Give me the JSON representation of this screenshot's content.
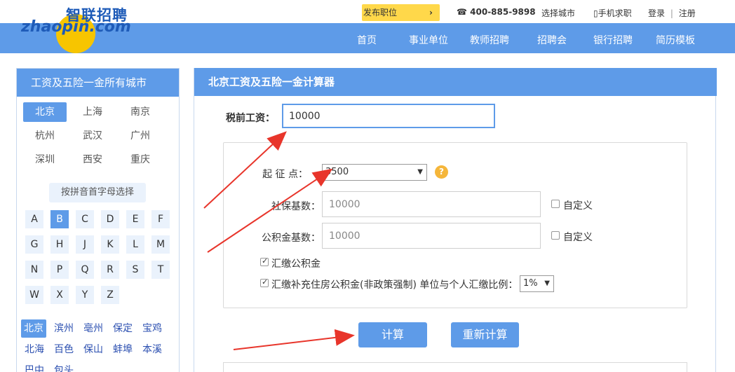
{
  "logo": {
    "cn": "智联招聘",
    "en": "zhaopin.com"
  },
  "topbar": {
    "post_job": "发布职位",
    "phone": "400-885-9898",
    "phone_icon": "phone-icon",
    "select_city": "选择城市",
    "mobile_job": "手机求职",
    "mobile_icon": "mobile-icon",
    "login": "登录",
    "separator": "|",
    "register": "注册"
  },
  "nav": {
    "items": [
      "首页",
      "事业单位",
      "教师招聘",
      "招聘会",
      "银行招聘",
      "简历模板"
    ]
  },
  "left_panel": {
    "title": "工资及五险一金所有城市",
    "hot_cities": [
      "北京",
      "上海",
      "南京",
      "杭州",
      "武汉",
      "广州",
      "深圳",
      "西安",
      "重庆"
    ],
    "active_city": "北京",
    "pinyin_button": "按拼音首字母选择",
    "letters": [
      "A",
      "B",
      "C",
      "D",
      "E",
      "F",
      "G",
      "H",
      "J",
      "K",
      "L",
      "M",
      "N",
      "P",
      "Q",
      "R",
      "S",
      "T",
      "W",
      "X",
      "Y",
      "Z"
    ],
    "active_letter": "B",
    "b_cities": [
      "北京",
      "滨州",
      "亳州",
      "保定",
      "宝鸡",
      "北海",
      "百色",
      "保山",
      "蚌埠",
      "本溪",
      "巴中",
      "包头"
    ]
  },
  "calculator": {
    "title": "北京工资及五险一金计算器",
    "salary_label": "税前工资：",
    "salary_value": "10000",
    "threshold_label": "起 征 点：",
    "threshold_value": "3500",
    "help_symbol": "?",
    "social_label": "社保基数：",
    "social_value": "10000",
    "housing_label": "公积金基数：",
    "housing_value": "10000",
    "custom_label": "自定义",
    "pay_housing_label": "汇缴公积金",
    "pay_supplement_label": "汇缴补充住房公积金(非政策强制) 单位与个人汇缴比例：",
    "ratio_value": "1%",
    "calc_button": "计算",
    "recalc_button": "重新计算"
  },
  "colors": {
    "accent": "#5e9be8",
    "yellow": "#ffd84a",
    "arrow": "#e8352b"
  }
}
